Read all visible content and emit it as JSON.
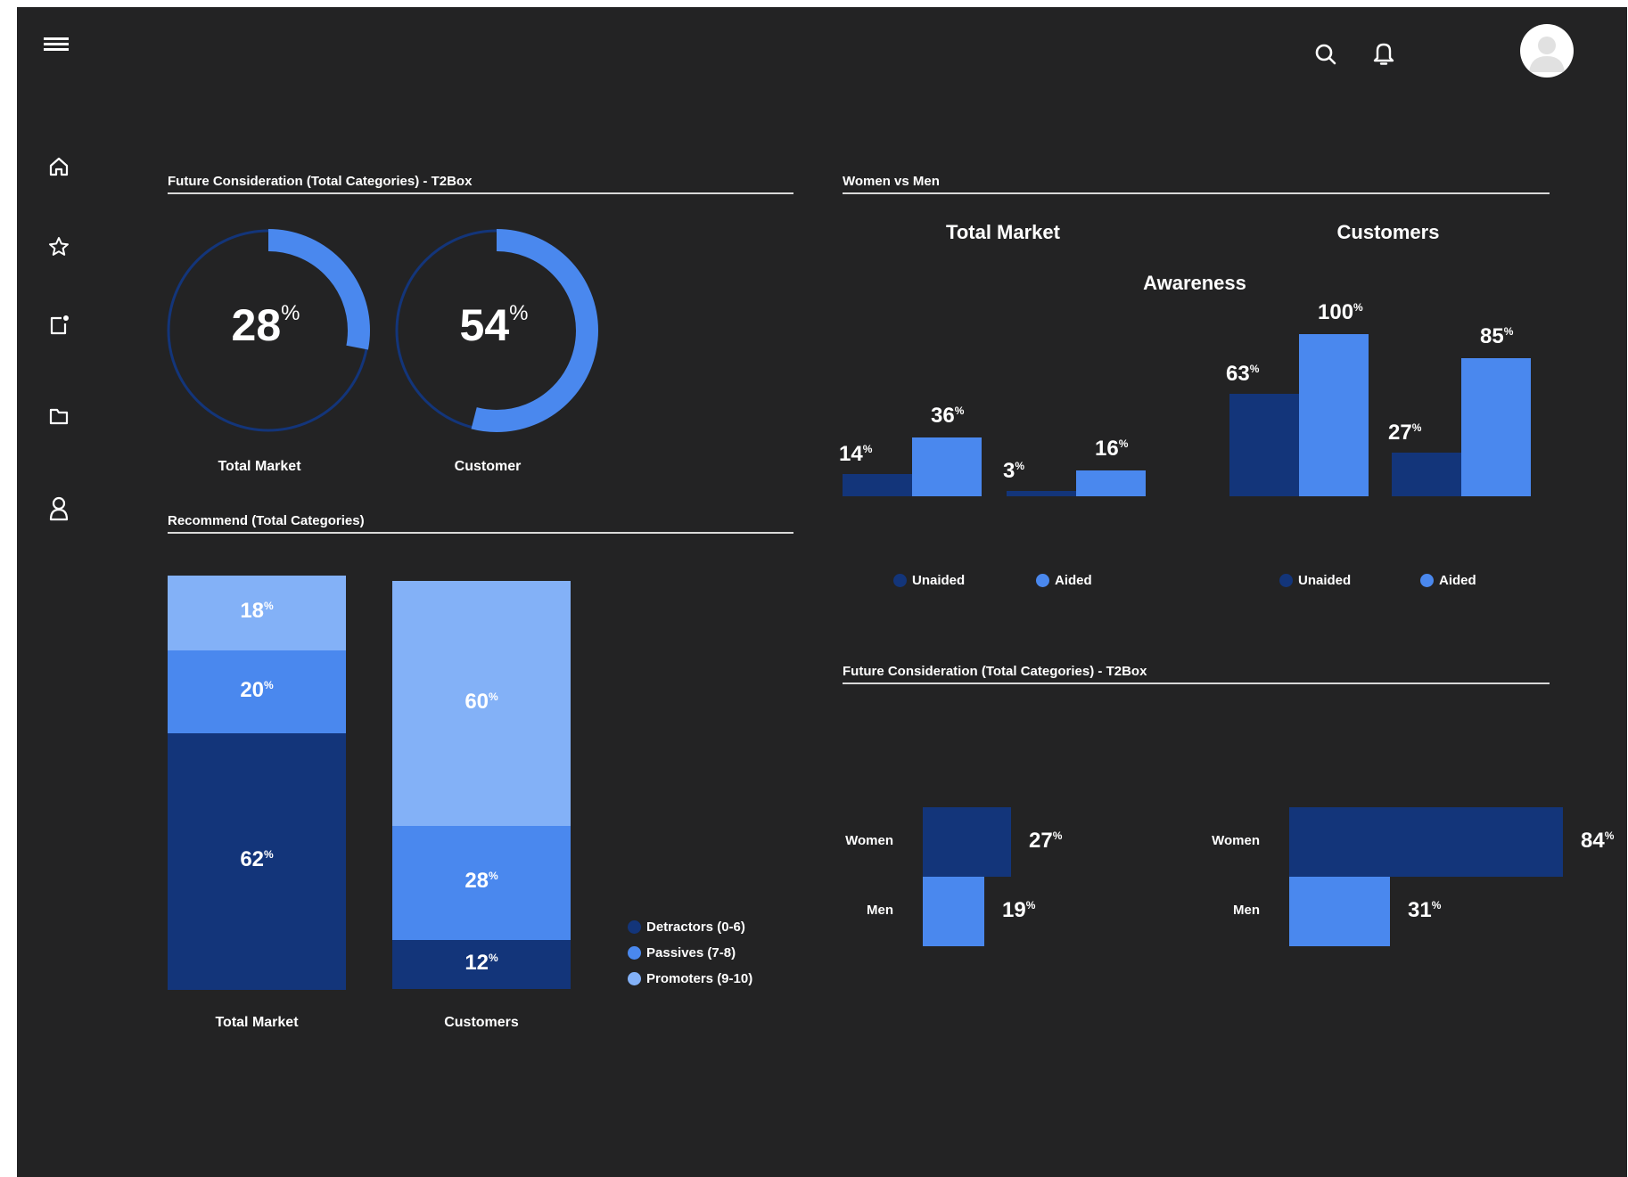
{
  "colors": {
    "background": "#232324",
    "dark_blue": "#13357a",
    "mid_blue": "#4a88ee",
    "light_blue": "#83b1f7",
    "rule": "#d9d9d9"
  },
  "topbar": {
    "icons": [
      "menu-icon",
      "search-icon",
      "bell-icon",
      "avatar"
    ]
  },
  "sidebar": {
    "icons": [
      "home-icon",
      "star-icon",
      "notes-icon",
      "folder-icon",
      "user-icon"
    ]
  },
  "consideration_panel": {
    "title": "Future Consideration (Total Categories) - T2Box",
    "gauges": [
      {
        "value": "28",
        "unit": "%",
        "label": "Total Market",
        "fraction": 0.28
      },
      {
        "value": "54",
        "unit": "%",
        "label": "Customer",
        "fraction": 0.54
      }
    ]
  },
  "recommend_panel": {
    "title": "Recommend (Total Categories)",
    "bars": [
      {
        "label": "Total Market",
        "segments": [
          {
            "value": 18,
            "text": "18",
            "color": "light"
          },
          {
            "value": 20,
            "text": "20",
            "color": "mid"
          },
          {
            "value": 62,
            "text": "62",
            "color": "dark"
          }
        ]
      },
      {
        "label": "Customers",
        "segments": [
          {
            "value": 60,
            "text": "60",
            "color": "light"
          },
          {
            "value": 28,
            "text": "28",
            "color": "mid"
          },
          {
            "value": 12,
            "text": "12",
            "color": "dark"
          }
        ]
      }
    ],
    "legend": [
      {
        "label": "Detractors (0-6)",
        "color": "dark"
      },
      {
        "label": "Passives (7-8)",
        "color": "mid"
      },
      {
        "label": "Promoters (9-10)",
        "color": "light"
      }
    ],
    "percent_sign": "%"
  },
  "women_men_panel": {
    "title": "Women vs Men",
    "heading_left": "Total Market",
    "heading_right": "Customers",
    "subheading": "Awareness",
    "legend_left": [
      {
        "label": "Unaided",
        "color": "dark"
      },
      {
        "label": "Aided",
        "color": "mid"
      }
    ],
    "legend_right": [
      {
        "label": "Unaided",
        "color": "dark"
      },
      {
        "label": "Aided",
        "color": "mid"
      }
    ]
  },
  "future_panel": {
    "title": "Future Consideration (Total Categories) - T2Box",
    "groups": [
      {
        "rows": [
          {
            "label": "Women",
            "value": 27,
            "text": "27",
            "color": "dark"
          },
          {
            "label": "Men",
            "value": 19,
            "text": "19",
            "color": "mid"
          }
        ]
      },
      {
        "rows": [
          {
            "label": "Women",
            "value": 84,
            "text": "84",
            "color": "dark"
          },
          {
            "label": "Men",
            "value": 31,
            "text": "31",
            "color": "mid"
          }
        ]
      }
    ]
  },
  "chart_data": [
    {
      "type": "pie",
      "title": "Future Consideration (Total Categories) - T2Box",
      "labels": [
        "Total Market",
        "Customer"
      ],
      "values": [
        28,
        54
      ],
      "unit": "%"
    },
    {
      "type": "bar",
      "title": "Recommend (Total Categories)",
      "stacked": true,
      "categories": [
        "Total Market",
        "Customers"
      ],
      "series": [
        {
          "name": "Detractors (0-6)",
          "values": [
            62,
            12
          ]
        },
        {
          "name": "Passives (7-8)",
          "values": [
            20,
            28
          ]
        },
        {
          "name": "Promoters (9-10)",
          "values": [
            18,
            60
          ]
        }
      ]
    },
    {
      "type": "bar",
      "title": "Women vs Men",
      "subtitle": "Awareness",
      "groups": [
        "Total Market",
        "Customers"
      ],
      "series": [
        {
          "name": "Unaided",
          "values": [
            14,
            3,
            63,
            27
          ]
        },
        {
          "name": "Aided",
          "values": [
            36,
            16,
            100,
            85
          ]
        }
      ]
    },
    {
      "type": "bar",
      "orientation": "horizontal",
      "title": "Future Consideration (Total Categories) - T2Box",
      "categories": [
        "Women",
        "Men"
      ],
      "series": [
        {
          "values": [
            27,
            19
          ]
        },
        {
          "values": [
            84,
            31
          ]
        }
      ]
    }
  ]
}
